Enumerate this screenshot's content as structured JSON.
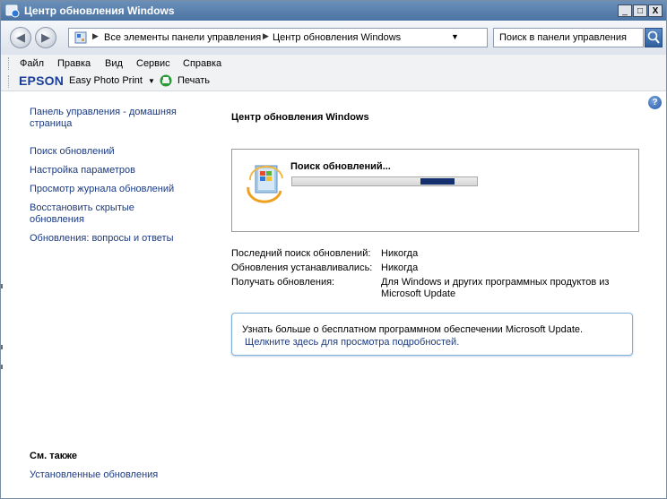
{
  "window": {
    "title": "Центр обновления Windows",
    "buttons": {
      "minimize": "_",
      "maximize": "□",
      "close": "X"
    }
  },
  "address_bar": {
    "crumbs": [
      "Все элементы панели управления",
      "Центр обновления Windows"
    ],
    "search_placeholder": "Поиск в панели управления"
  },
  "menu": [
    "Файл",
    "Правка",
    "Вид",
    "Сервис",
    "Справка"
  ],
  "epson_toolbar": {
    "logo": "EPSON",
    "photo_print": "Easy Photo Print",
    "print": "Печать"
  },
  "sidebar": {
    "home": "Панель управления - домашняя страница",
    "links": [
      "Поиск обновлений",
      "Настройка параметров",
      "Просмотр журнала обновлений",
      "Восстановить скрытые обновления",
      "Обновления: вопросы и ответы"
    ],
    "see_also_title": "См. также",
    "see_also_link": "Установленные обновления"
  },
  "main": {
    "title": "Центр обновления Windows",
    "status_text": "Поиск обновлений...",
    "progress_indeterminate": true,
    "info": [
      {
        "label": "Последний поиск обновлений:",
        "value": "Никогда"
      },
      {
        "label": "Обновления устанавливались:",
        "value": "Никогда"
      },
      {
        "label": "Получать обновления:",
        "value": "Для Windows и других программных продуктов из Microsoft Update"
      }
    ],
    "microsoft_update_box": {
      "text": "Узнать больше о бесплатном программном обеспечении Microsoft Update.",
      "link": "Щелкните здесь для просмотра подробностей."
    }
  },
  "icons": [
    "app-icon",
    "back-icon",
    "forward-icon",
    "control-panel-icon",
    "refresh-icon",
    "search-icon",
    "print-icon",
    "help-icon",
    "windows-update-icon"
  ],
  "colors": {
    "titlebar": "#4c74a3",
    "link": "#1c3a80",
    "progress": "#14306e",
    "epson": "#1b3f98"
  }
}
